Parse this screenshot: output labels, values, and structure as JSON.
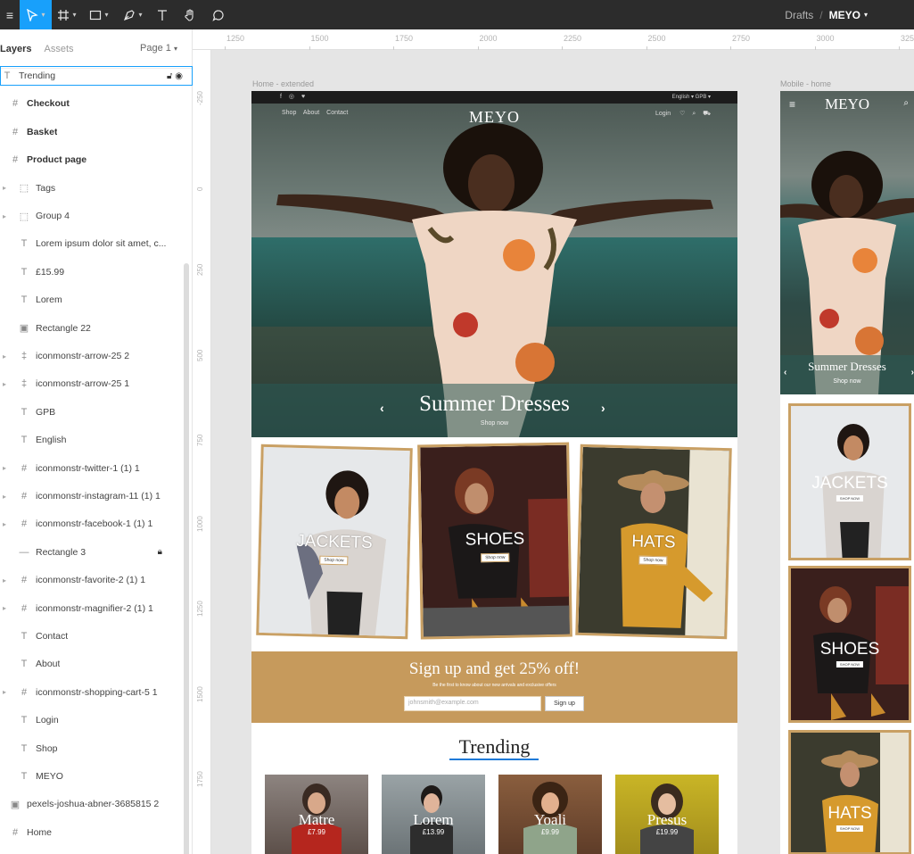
{
  "toolbar": {
    "breadcrumb_project": "Drafts",
    "breadcrumb_separator": "/",
    "breadcrumb_file": "MEYO"
  },
  "layers_panel": {
    "tab_layers": "Layers",
    "tab_assets": "Assets",
    "page": "Page 1",
    "rows": [
      {
        "icon": "text-icon",
        "name": "Trending",
        "selected": true
      },
      {
        "icon": "frame-icon",
        "name": "Checkout"
      },
      {
        "icon": "frame-icon",
        "name": "Basket"
      },
      {
        "icon": "frame-icon",
        "name": "Product page"
      },
      {
        "icon": "group-icon",
        "name": "Tags"
      },
      {
        "icon": "group-icon",
        "name": "Group 4"
      },
      {
        "icon": "text-icon",
        "name": "Lorem ipsum dolor sit amet, c..."
      },
      {
        "icon": "text-icon",
        "name": "£15.99"
      },
      {
        "icon": "text-icon",
        "name": "Lorem"
      },
      {
        "icon": "image-icon",
        "name": "Rectangle 22"
      },
      {
        "icon": "component-icon",
        "name": "iconmonstr-arrow-25 2"
      },
      {
        "icon": "component-icon",
        "name": "iconmonstr-arrow-25 1"
      },
      {
        "icon": "text-icon",
        "name": "GPB"
      },
      {
        "icon": "text-icon",
        "name": "English"
      },
      {
        "icon": "frame-icon",
        "name": "iconmonstr-twitter-1 (1) 1"
      },
      {
        "icon": "frame-icon",
        "name": "iconmonstr-instagram-11 (1) 1"
      },
      {
        "icon": "frame-icon",
        "name": "iconmonstr-facebook-1 (1) 1"
      },
      {
        "icon": "line-icon",
        "name": "Rectangle 3"
      },
      {
        "icon": "frame-icon",
        "name": "iconmonstr-favorite-2 (1) 1"
      },
      {
        "icon": "frame-icon",
        "name": "iconmonstr-magnifier-2 (1) 1"
      },
      {
        "icon": "text-icon",
        "name": "Contact"
      },
      {
        "icon": "text-icon",
        "name": "About"
      },
      {
        "icon": "frame-icon",
        "name": "iconmonstr-shopping-cart-5 1"
      },
      {
        "icon": "text-icon",
        "name": "Login"
      },
      {
        "icon": "text-icon",
        "name": "Shop"
      },
      {
        "icon": "text-icon",
        "name": "MEYO"
      },
      {
        "icon": "image-icon",
        "name": "pexels-joshua-abner-3685815 2"
      },
      {
        "icon": "frame-icon",
        "name": "Home"
      }
    ]
  },
  "rulers": {
    "top": [
      "1250",
      "1500",
      "1750",
      "2000",
      "2250",
      "2500",
      "2750",
      "3000",
      "325"
    ],
    "left": [
      "-250",
      "0",
      "250",
      "500",
      "750",
      "1000",
      "1250",
      "1500",
      "1750"
    ]
  },
  "canvas": {
    "home_label": "Home - extended",
    "mobile_label": "Mobile - home"
  },
  "home": {
    "nav": [
      "Shop",
      "About",
      "Contact"
    ],
    "logo": "MEYO",
    "account": "Login",
    "lang": "English ▾   GPB ▾",
    "hero_title": "Summer Dresses",
    "hero_sub": "Shop now",
    "categories": [
      {
        "label": "JACKETS",
        "btn": "Shop now"
      },
      {
        "label": "SHOES",
        "btn": "Shop now"
      },
      {
        "label": "HATS",
        "btn": "Shop now"
      }
    ],
    "signup_title": "Sign up and get 25% off!",
    "signup_desc": "Be the first to know about our new arrivals and exclusive offers",
    "signup_placeholder": "johnsmith@example.com",
    "signup_button": "Sign up",
    "trending_title": "Trending",
    "trending": [
      {
        "name": "Matre",
        "price": "£7.99"
      },
      {
        "name": "Lorem",
        "price": "£13.99"
      },
      {
        "name": "Yoali",
        "price": "£9.99"
      },
      {
        "name": "Presus",
        "price": "£19.99"
      }
    ]
  },
  "mobile": {
    "logo": "MEYO",
    "hero_title": "Summer Dresses",
    "hero_sub": "Shop now",
    "categories": [
      {
        "label": "JACKETS",
        "btn": "SHOP NOW"
      },
      {
        "label": "SHOES",
        "btn": "SHOP NOW"
      },
      {
        "label": "HATS",
        "btn": "SHOP NOW"
      }
    ]
  }
}
